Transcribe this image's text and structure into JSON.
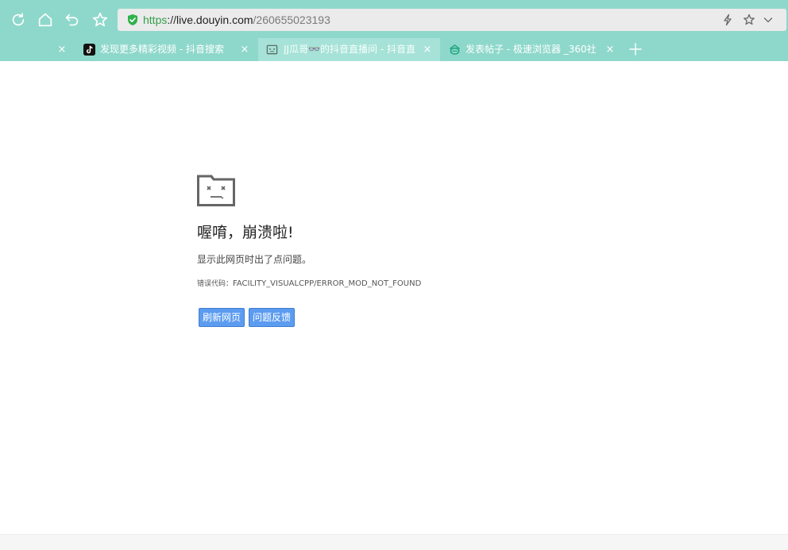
{
  "toolbar": {
    "refresh_icon": "refresh-icon",
    "home_icon": "home-icon",
    "back_icon": "undo-back-icon",
    "favorite_icon": "star-icon"
  },
  "address_bar": {
    "scheme": "https",
    "separator": "://",
    "host": "live.douyin.com",
    "path": "/260655023193",
    "secure_icon": "shield-check-icon",
    "secure_color": "#2fb24a",
    "right_icons": [
      "lightning-icon",
      "star-icon",
      "chevron-down-icon"
    ]
  },
  "tabs": [
    {
      "title": "",
      "active": false
    },
    {
      "title": "发现更多精彩视频 - 抖音搜索",
      "favicon": "douyin-icon",
      "active": false
    },
    {
      "title": "JJ瓜哥👓的抖音直播间 - 抖音直",
      "favicon": "live-room-icon",
      "active": true
    },
    {
      "title": "发表帖子 - 极速浏览器 _360社",
      "favicon": "360-community-icon",
      "active": false
    }
  ],
  "tab_close_glyph": "×",
  "new_tab_icon": "plus-icon",
  "crash_page": {
    "icon": "crashed-folder-icon",
    "title": "喔唷，崩溃啦!",
    "description": "显示此网页时出了点问题。",
    "error_label": "错误代码：",
    "error_code": "FACILITY_VISUALCPP/ERROR_MOD_NOT_FOUND",
    "reload_button": "刷新网页",
    "feedback_button": "问题反馈"
  },
  "colors": {
    "chrome_bg": "#8ed8cb",
    "active_tab": "#a6e2d7",
    "button_blue": "#5c9cf0"
  }
}
